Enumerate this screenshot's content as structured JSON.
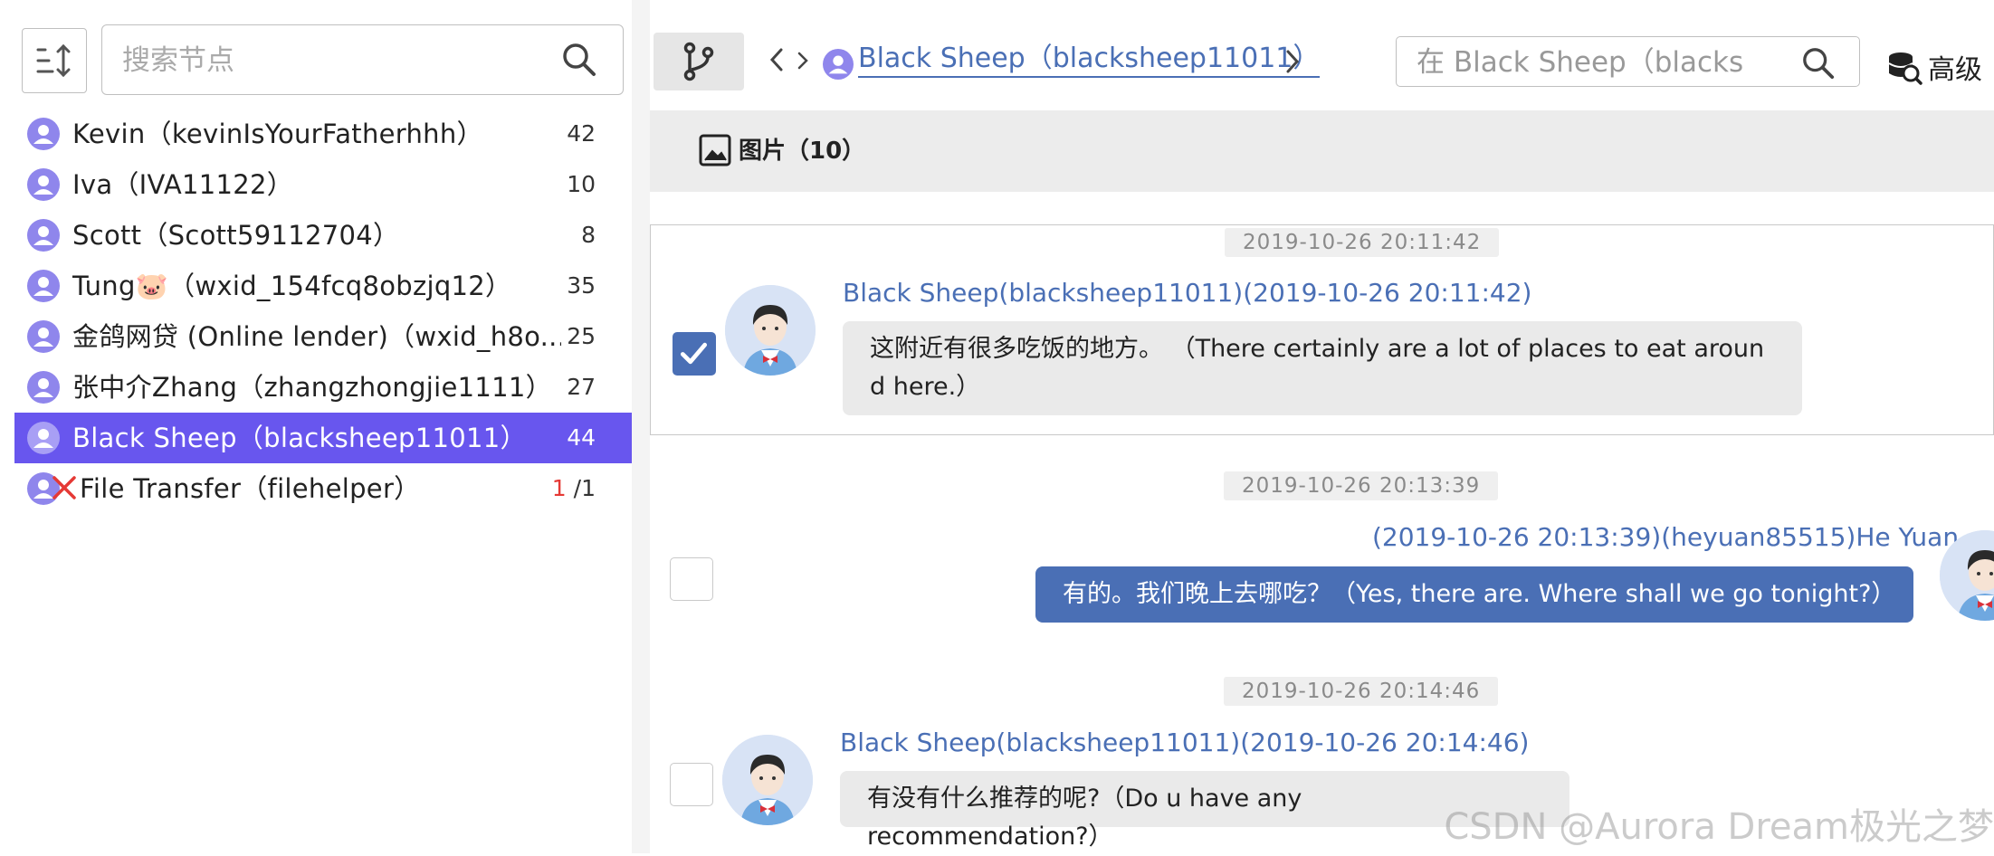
{
  "sidebar": {
    "search_placeholder": "搜索节点",
    "nodes": [
      {
        "label": "Kevin（kevinIsYourFatherhhh）",
        "count": "42"
      },
      {
        "label": "Iva（IVA11122）",
        "count": "10"
      },
      {
        "label": "Scott（Scott59112704）",
        "count": "8"
      },
      {
        "label": "Tung🐷（wxid_154fcq8obzjq12）",
        "count": "35"
      },
      {
        "label": "金鸽网贷 (Online lender)（wxid_h8o...",
        "count": "25"
      },
      {
        "label": "张中介Zhang（zhangzhongjie1111）",
        "count": "27"
      },
      {
        "label": "Black Sheep（blacksheep11011）",
        "count": "44",
        "selected": true
      },
      {
        "label": "File Transfer（filehelper）",
        "count_red": "1",
        "count": "/1"
      }
    ]
  },
  "toolbar": {
    "breadcrumb": "Black Sheep（blacksheep11011）",
    "search_placeholder": "在 Black Sheep（blacks",
    "advanced_label": "高级"
  },
  "filter": {
    "label": "图片（10）"
  },
  "messages": [
    {
      "timestamp": "2019-10-26 20:11:42",
      "sender": "Black Sheep(blacksheep11011)(2019-10-26 20:11:42)",
      "text_line1": "这附近有很多吃饭的地方。  （There certainly are a lot of places to eat aroun",
      "text_line2": "d here.）",
      "direction": "in",
      "checked": true
    },
    {
      "timestamp": "2019-10-26 20:13:39",
      "sender": "(2019-10-26 20:13:39)(heyuan85515)He Yuan",
      "text_line1": "有的。我们晚上去哪吃？（Yes, there are. Where shall we go tonight?）",
      "direction": "out",
      "checked": false
    },
    {
      "timestamp": "2019-10-26 20:14:46",
      "sender": "Black Sheep(blacksheep11011)(2019-10-26 20:14:46)",
      "text_line1": "有没有什么推荐的呢?（Do u have any recommendation?）",
      "direction": "in",
      "checked": false
    }
  ],
  "watermark": "CSDN @Aurora Dream极光之梦",
  "colors": {
    "accent": "#6856ee",
    "link": "#4a6fb5",
    "bubble_in": "#eaeaea",
    "bubble_out": "#4a6fb5",
    "red": "#e53935"
  }
}
